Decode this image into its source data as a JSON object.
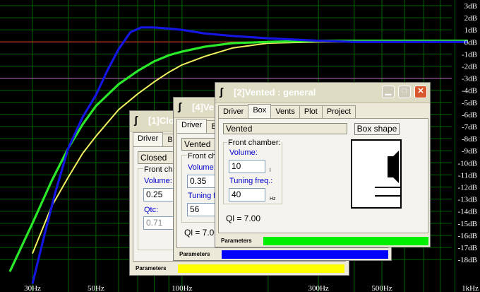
{
  "chart_data": {
    "type": "line",
    "x_scale": "log",
    "xlim": [
      25,
      1000
    ],
    "ylim": [
      -19,
      3
    ],
    "x_ticks": [
      30,
      50,
      100,
      300,
      500,
      1000
    ],
    "x_tick_labels": [
      "30Hz",
      "50Hz",
      "100Hz",
      "300Hz",
      "500Hz",
      "1kHz"
    ],
    "y_ticks": [
      3,
      2,
      1,
      0,
      -1,
      -2,
      -3,
      -4,
      -5,
      -6,
      -7,
      -8,
      -9,
      -10,
      -11,
      -12,
      -13,
      -14,
      -15,
      -16,
      -17,
      -18
    ],
    "y_tick_labels": [
      "3dB",
      "2dB",
      "1dB",
      "0dB",
      "-1dB",
      "-2dB",
      "-3dB",
      "-4dB",
      "-5dB",
      "-6dB",
      "-7dB",
      "-8dB",
      "-9dB",
      "-10dB",
      "-11dB",
      "-12dB",
      "-13dB",
      "-14dB",
      "-15dB",
      "-16dB",
      "-17dB",
      "-18dB"
    ],
    "grid": true,
    "reference_lines": [
      {
        "y": 0,
        "color": "#ff3030"
      },
      {
        "y": -3,
        "color": "#c05fc0"
      }
    ],
    "series": [
      {
        "color": "#1515e0",
        "x": [
          30,
          33,
          36,
          40,
          45,
          50,
          55,
          60,
          66,
          72,
          80,
          90,
          100,
          120,
          150,
          200,
          300,
          400,
          500,
          700,
          1000
        ],
        "y": [
          -20,
          -16,
          -12.5,
          -8.8,
          -6.2,
          -4.4,
          -2.3,
          -0.6,
          0.8,
          1.2,
          1.2,
          1.1,
          1.0,
          0.7,
          0.5,
          0.3,
          0.1,
          0.0,
          0.0,
          0.0,
          0.0
        ]
      },
      {
        "color": "#2ae82a",
        "x": [
          25,
          30,
          35,
          40,
          45,
          50,
          60,
          70,
          80,
          90,
          100,
          120,
          150,
          200,
          300,
          500,
          1000
        ],
        "y": [
          -19,
          -15,
          -11.5,
          -8.8,
          -6.8,
          -5.3,
          -3.5,
          -2.4,
          -1.6,
          -1.1,
          -0.8,
          -0.4,
          -0.1,
          0.0,
          0.1,
          0.1,
          0.1
        ]
      },
      {
        "color": "#f0f060",
        "x": [
          30,
          35,
          40,
          45,
          50,
          60,
          70,
          80,
          90,
          100,
          120,
          150,
          200,
          300,
          500,
          1000
        ],
        "y": [
          -17.5,
          -13.6,
          -11.2,
          -9.2,
          -7.8,
          -5.6,
          -4.3,
          -3.3,
          -2.5,
          -1.9,
          -1.2,
          -0.5,
          -0.1,
          0.0,
          0.0,
          0.0
        ]
      }
    ]
  },
  "windows": {
    "closed": {
      "title": "[1]Clo",
      "tabs": [
        "Driver",
        "B"
      ],
      "type_value": "Closed",
      "group_label": "Front cha",
      "volume_label": "Volume:",
      "volume_value": "0.25",
      "qtc_label": "Qtc:",
      "qtc_value": "0.71",
      "params_label": "Parameters",
      "bar_color": "#ffff00"
    },
    "vented4": {
      "title": "[4]Ve",
      "tabs": [
        "Driver",
        "B"
      ],
      "type_value": "Vented",
      "group_label": "Front ch",
      "volume_label": "Volume:",
      "volume_value": "0.35",
      "tuning_label": "Tuning fr",
      "tuning_value": "56",
      "ql_text": "Ql = 7.00",
      "params_label": "Parameters",
      "bar_color": "#0000ff"
    },
    "vented2": {
      "title": "[2]Vented : general",
      "tabs": [
        "Driver",
        "Box",
        "Vents",
        "Plot",
        "Project"
      ],
      "type_value": "Vented",
      "box_shape_label": "Box shape",
      "group_label": "Front chamber:",
      "volume_label": "Volume:",
      "volume_value": "10",
      "volume_unit": "l",
      "tuning_label": "Tuning freq.:",
      "tuning_value": "40",
      "tuning_unit": "Hz",
      "ql_text": "Ql = 7.00",
      "params_label": "Parameters",
      "bar_color": "#00ee00"
    }
  }
}
